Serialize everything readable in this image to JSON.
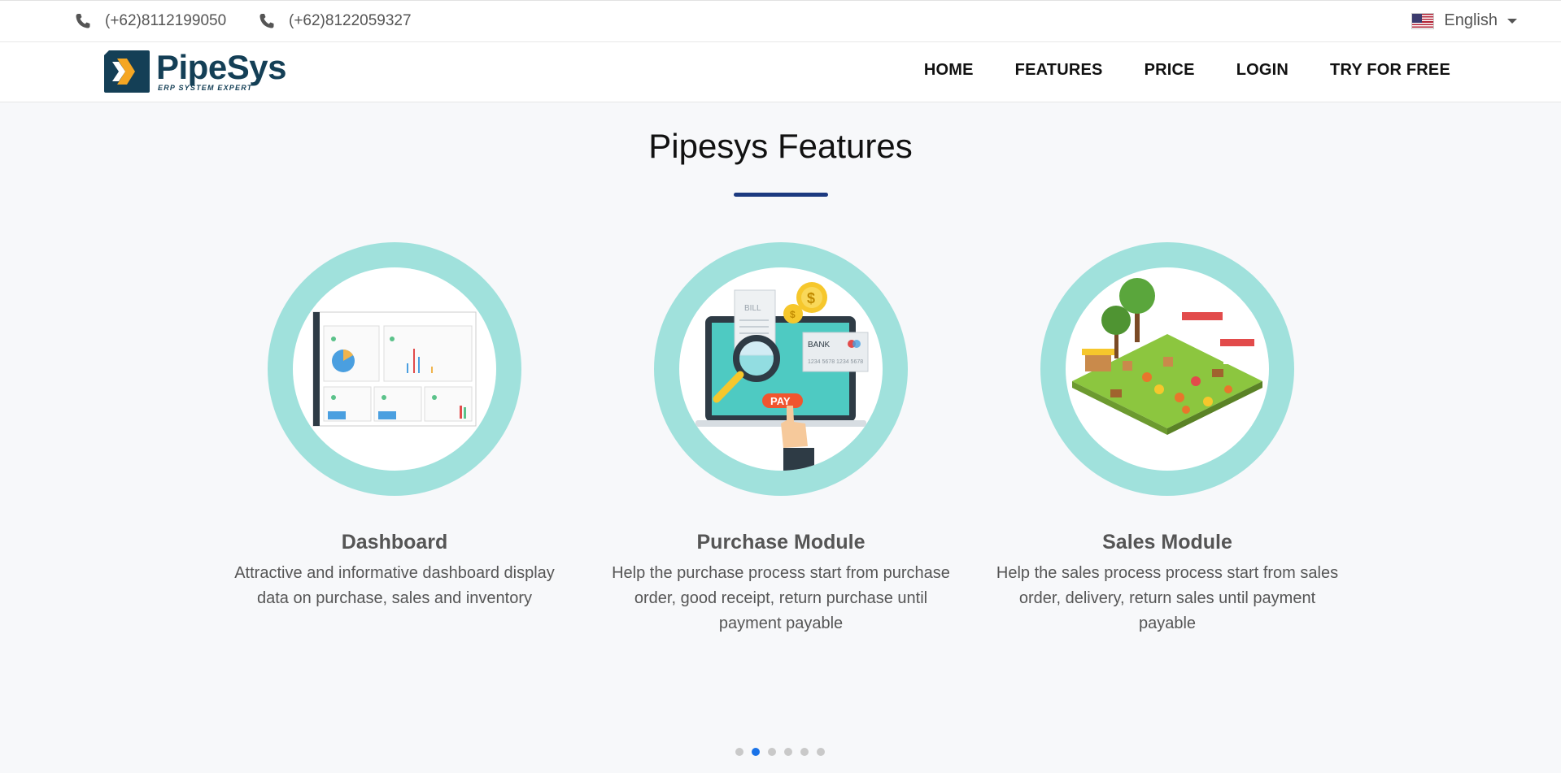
{
  "topbar": {
    "phones": [
      "(+62)8112199050",
      "(+62)8122059327"
    ],
    "language": "English",
    "language_icon": "us-flag-icon"
  },
  "brand": {
    "name": "PipeSys",
    "tagline": "ERP SYSTEM EXPERT"
  },
  "nav": {
    "items": [
      "HOME",
      "FEATURES",
      "PRICE",
      "LOGIN",
      "TRY FOR FREE"
    ]
  },
  "section": {
    "title": "Pipesys Features"
  },
  "features": [
    {
      "title": "Dashboard",
      "description": "Attractive and informative dashboard display data on purchase, sales and inventory",
      "icon": "dashboard-illustration"
    },
    {
      "title": "Purchase Module",
      "description": "Help the purchase process start from purchase order, good receipt, return purchase until payment payable",
      "icon": "purchase-illustration",
      "labels": {
        "bill": "BILL",
        "bank": "BANK",
        "card": "1234 5678 1234 5678",
        "pay": "PAY",
        "coin": "$"
      }
    },
    {
      "title": "Sales Module",
      "description": "Help the sales process process start from sales order, delivery, return sales until payment payable",
      "icon": "market-illustration"
    }
  ],
  "carousel": {
    "total": 6,
    "active_index": 1
  },
  "colors": {
    "accent": "#1c3a80",
    "circle": "#a0e1dc",
    "dot_active": "#1a73e8",
    "logo": "#143f56"
  }
}
